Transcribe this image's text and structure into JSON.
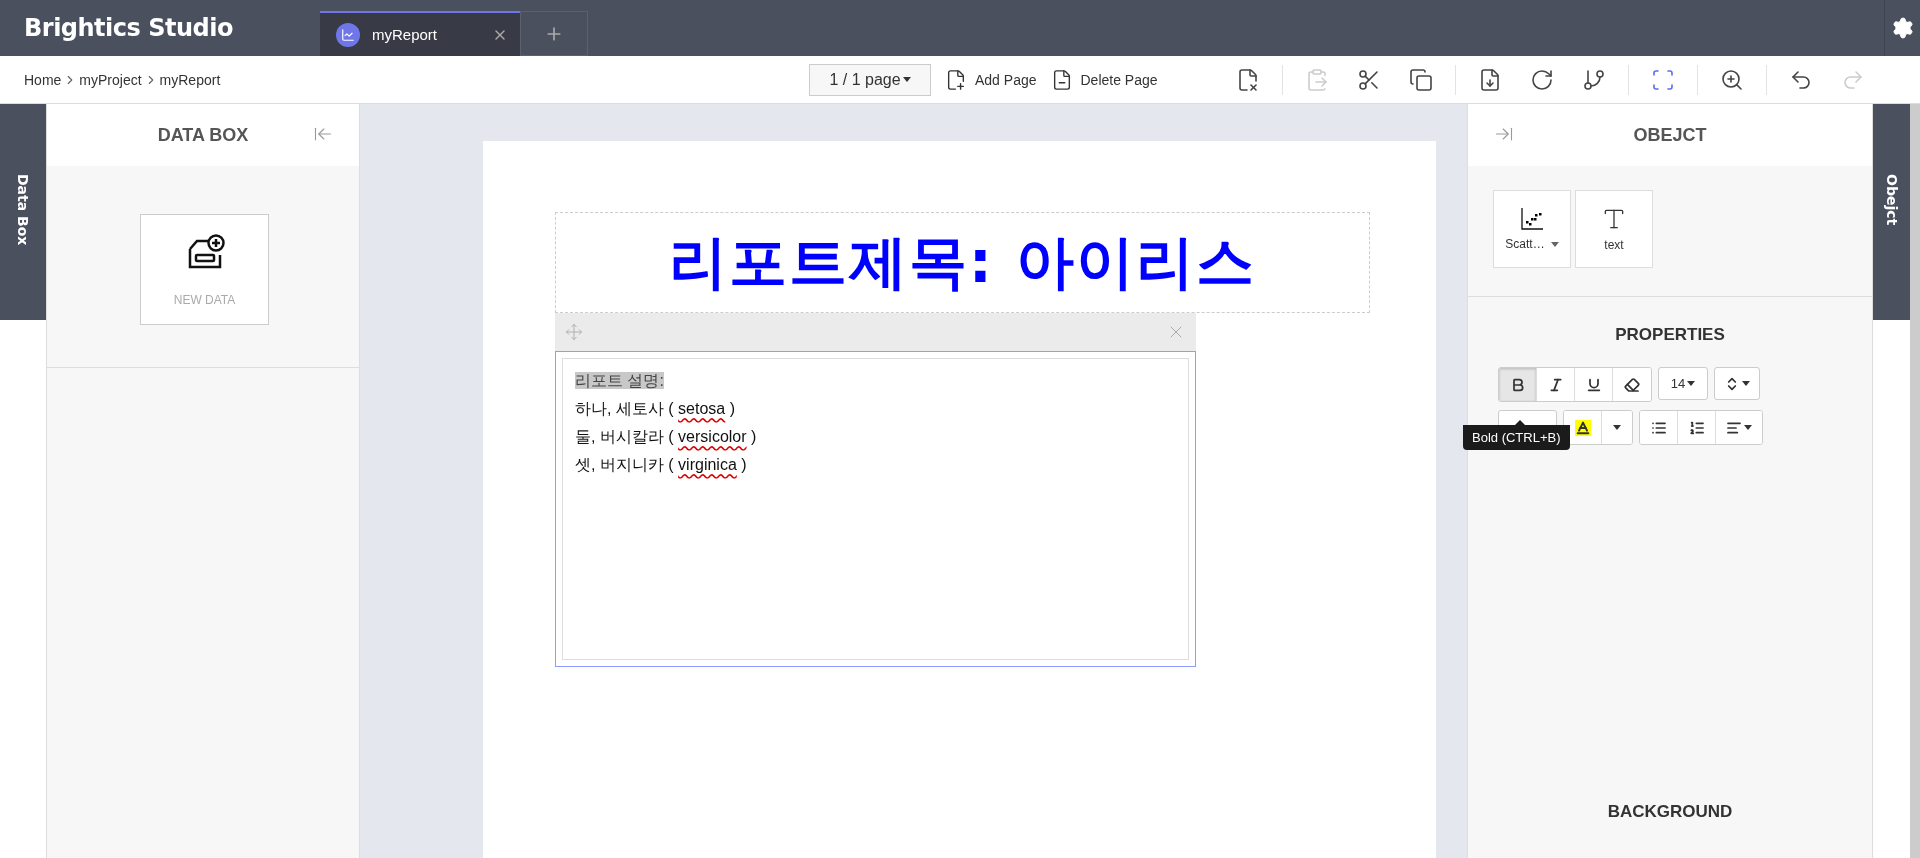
{
  "app": {
    "title": "Brightics Studio"
  },
  "tabs": [
    {
      "label": "myReport",
      "selected": true
    }
  ],
  "breadcrumb": [
    "Home",
    "myProject",
    "myReport"
  ],
  "page_selector": {
    "value": "1 / 1 page"
  },
  "page_actions": [
    {
      "kind": "add",
      "label": "Add Page"
    },
    {
      "kind": "delete",
      "label": "Delete Page"
    }
  ],
  "toolbar": [
    {
      "kind": "clear",
      "disabled": false,
      "active": false
    },
    {
      "kind": "paste",
      "disabled": true,
      "active": false
    },
    {
      "kind": "cut",
      "disabled": false,
      "active": false
    },
    {
      "kind": "copy",
      "disabled": false,
      "active": false
    },
    {
      "kind": "pdf",
      "disabled": false,
      "active": false
    },
    {
      "kind": "refresh",
      "disabled": false,
      "active": false
    },
    {
      "kind": "branch",
      "disabled": false,
      "active": false
    },
    {
      "kind": "fit",
      "disabled": false,
      "active": true
    },
    {
      "kind": "zoom",
      "disabled": false,
      "active": false
    },
    {
      "kind": "undo",
      "disabled": false,
      "active": false
    },
    {
      "kind": "redo",
      "disabled": true,
      "active": false
    }
  ],
  "left_panel": {
    "tab": "Data Box",
    "title": "DATA BOX",
    "new_data": "NEW DATA"
  },
  "report": {
    "title": "리포트제목: 아이리스",
    "lines": [
      {
        "text": "리포트 설명:",
        "selected": true
      },
      {
        "text": "하나, 세토사 ( ",
        "word": "setosa",
        "tail": " )",
        "selected": false
      },
      {
        "text": "둘, 버시칼라 ( ",
        "word": "versicolor",
        "tail": " )",
        "selected": false
      },
      {
        "text": "셋, 버지니카 ( ",
        "word": "virginica",
        "tail": " )",
        "selected": false
      }
    ]
  },
  "right_panel": {
    "tab": "Obejct",
    "title": "OBEJCT",
    "objects": [
      {
        "kind": "scatter",
        "label": "Scatt…"
      },
      {
        "kind": "text",
        "label": "text"
      }
    ],
    "properties_title": "PROPERTIES",
    "format_rows": [
      [
        [
          {
            "kind": "bold",
            "pressed": true
          },
          {
            "kind": "italic",
            "pressed": false
          },
          {
            "kind": "underline",
            "pressed": false
          },
          {
            "kind": "eraser",
            "pressed": false
          }
        ],
        [
          {
            "kind": "size",
            "label": "14",
            "pressed": false
          }
        ],
        [
          {
            "kind": "line-height",
            "pressed": false
          }
        ]
      ],
      [
        [
          {
            "kind": "font-color",
            "pressed": false
          }
        ],
        [
          {
            "kind": "highlight",
            "pressed": false
          },
          {
            "kind": "caret",
            "pressed": false
          }
        ],
        [
          {
            "kind": "bullets",
            "pressed": false
          },
          {
            "kind": "numbers",
            "pressed": false
          },
          {
            "kind": "align",
            "pressed": false
          }
        ]
      ]
    ],
    "tooltip": "Bold (CTRL+B)",
    "background_title": "BACKGROUND"
  }
}
